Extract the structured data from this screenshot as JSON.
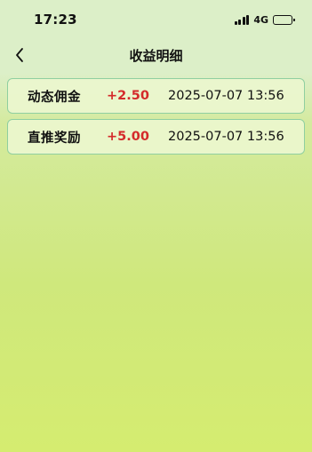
{
  "status_bar": {
    "time": "17:23",
    "network": "4G"
  },
  "nav": {
    "title": "收益明细",
    "back_icon": "chevron-left-icon"
  },
  "records": [
    {
      "type": "动态佣金",
      "amount": "+2.50",
      "time": "2025-07-07 13:56"
    },
    {
      "type": "直推奖励",
      "amount": "+5.00",
      "time": "2025-07-07 13:56"
    }
  ],
  "colors": {
    "amount": "#d42a2a",
    "card_border": "#8fcfa0",
    "background_top": "#dcefc8",
    "background_bottom": "#d5ec70"
  }
}
